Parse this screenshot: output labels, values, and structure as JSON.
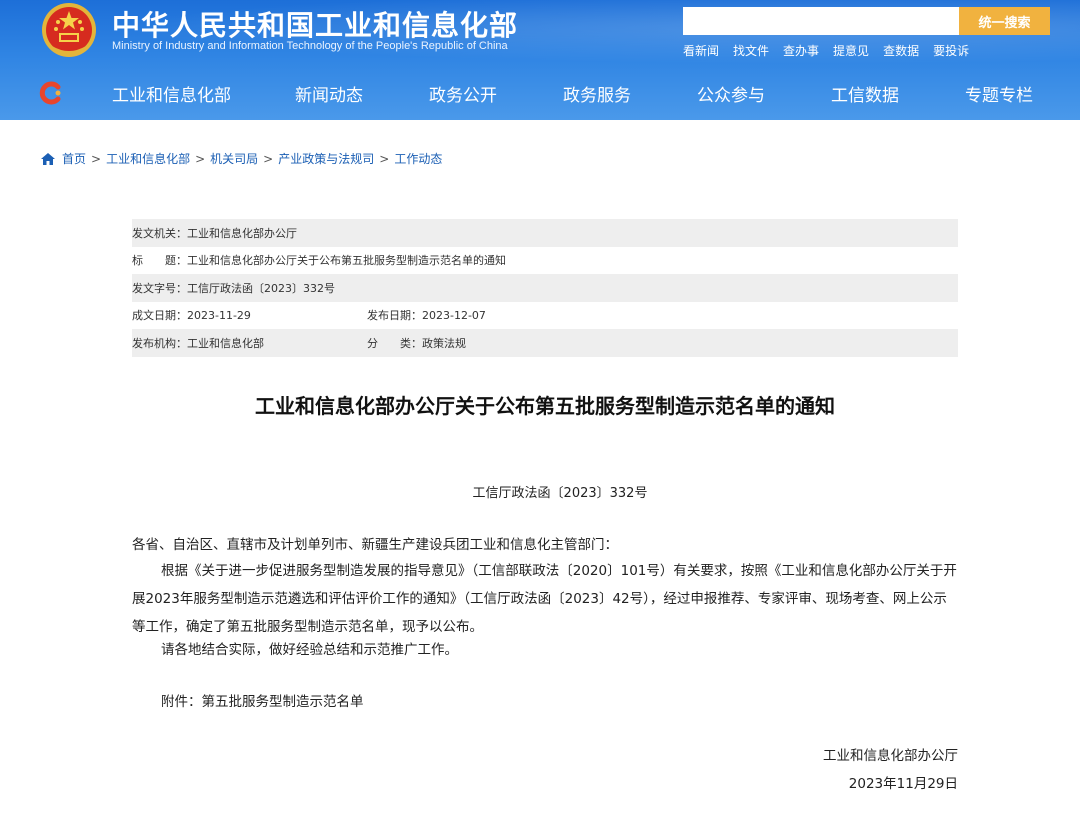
{
  "header": {
    "title": "中华人民共和国工业和信息化部",
    "subtitle": "Ministry of Industry and Information Technology of the People's Republic of China",
    "search_placeholder": "",
    "search_button": "统一搜索",
    "quick_links": [
      "看新闻",
      "找文件",
      "查办事",
      "提意见",
      "查数据",
      "要投诉"
    ]
  },
  "nav": {
    "items": [
      "工业和信息化部",
      "新闻动态",
      "政务公开",
      "政务服务",
      "公众参与",
      "工信数据",
      "专题专栏"
    ]
  },
  "breadcrumb": {
    "items": [
      "首页",
      "工业和信息化部",
      "机关司局",
      "产业政策与法规司",
      "工作动态"
    ],
    "separator": ">"
  },
  "meta": {
    "issuer_label": "发文机关：",
    "issuer": "工业和信息化部办公厅",
    "title_label": "标　　题：",
    "title": "工业和信息化部办公厅关于公布第五批服务型制造示范名单的通知",
    "doc_no_label": "发文字号：",
    "doc_no": "工信厅政法函〔2023〕332号",
    "written_label": "成文日期：",
    "written_date": "2023-11-29",
    "published_label": "发布日期：",
    "published_date": "2023-12-07",
    "org_label": "发布机构：",
    "org": "工业和信息化部",
    "category_label": "分　　类：",
    "category": "政策法规"
  },
  "document": {
    "title": "工业和信息化部办公厅关于公布第五批服务型制造示范名单的通知",
    "number": "工信厅政法函〔2023〕332号",
    "salutation": "各省、自治区、直辖市及计划单列市、新疆生产建设兵团工业和信息化主管部门：",
    "body1": "根据《关于进一步促进服务型制造发展的指导意见》（工信部联政法〔2020〕101号）有关要求，按照《工业和信息化部办公厅关于开展2023年服务型制造示范遴选和评估评价工作的通知》（工信厅政法函〔2023〕42号），经过申报推荐、专家评审、现场考查、网上公示等工作，确定了第五批服务型制造示范名单，现予以公布。",
    "body2": "请各地结合实际，做好经验总结和示范推广工作。",
    "attachment": "附件：第五批服务型制造示范名单",
    "signer": "工业和信息化部办公厅",
    "date": "2023年11月29日"
  },
  "colors": {
    "header_blue": "#2f84e3",
    "search_button": "#f1b23f",
    "link_blue": "#1b5fb4",
    "meta_shade": "#eeeeee"
  },
  "icons": [
    "national-emblem-icon",
    "site-logo-icon",
    "home-icon"
  ]
}
